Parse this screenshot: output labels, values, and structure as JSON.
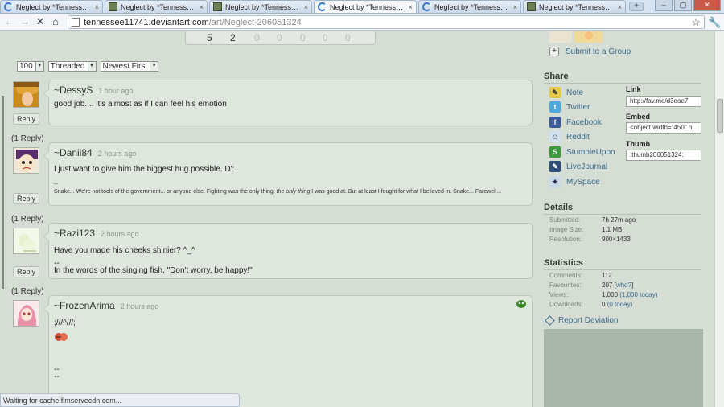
{
  "browser": {
    "tabs": [
      {
        "title": "Neglect by *Tennessee11...",
        "active": false
      },
      {
        "title": "Neglect by *Tennessee11...",
        "active": false
      },
      {
        "title": "Neglect by *Tennessee11...",
        "active": false
      },
      {
        "title": "Neglect by *Tennessee11...",
        "active": true
      },
      {
        "title": "Neglect by *Tennessee11...",
        "active": false
      },
      {
        "title": "Neglect by *Tennessee11...",
        "active": false
      }
    ],
    "new_tab_symbol": "+",
    "url_host": "tennessee11741.deviantart.com",
    "url_path": "/art/Neglect-206051324",
    "status_text": "Waiting for cache.fimservecdn.com...",
    "icons": {
      "back": "back-arrow-icon",
      "forward": "forward-arrow-icon",
      "stop": "stop-icon",
      "home": "home-icon",
      "star": "star-icon",
      "wrench": "wrench-icon"
    }
  },
  "pager": {
    "numbers": [
      "5",
      "2",
      "0",
      "0",
      "0",
      "0",
      "0"
    ]
  },
  "comment_controls": {
    "per_page": "100",
    "view": "Threaded",
    "order": "Newest First"
  },
  "comments": [
    {
      "user": "~DessyS",
      "time": "1 hour ago",
      "body": "good job.... it's almost as if I can feel his emotion",
      "reply_label": "Reply",
      "reply_count": "(1 Reply)"
    },
    {
      "user": "~Danii84",
      "time": "2 hours ago",
      "body": "I just want to give him the biggest hug possible. D':",
      "sig_dash": "--",
      "sig_pre": "Snake... We're not tools of the government... or anyone else. Fighting was the only thing, ",
      "sig_italic": "the only thing",
      "sig_post": " I was good at. But at least I fought for what I believed in. Snake... Farewell...",
      "reply_label": "Reply",
      "reply_count": "(1 Reply)"
    },
    {
      "user": "~Razi123",
      "time": "2 hours ago",
      "body": "Have you made his cheeks shinier? ^_^",
      "sig_dash": "--",
      "sig": "In the words of the singing fish, \"Don't worry, be happy!\"",
      "reply_label": "Reply",
      "reply_count": "(1 Reply)"
    },
    {
      "user": "~FrozenArima",
      "time": "2 hours ago",
      "body": ";///^///;",
      "dash1": "--",
      "dash2": "--",
      "dash3": "--"
    }
  ],
  "sidebar": {
    "submit_group": "Submit to a Group",
    "share_heading": "Share",
    "share_items": [
      "Note",
      "Twitter",
      "Facebook",
      "Reddit",
      "StumbleUpon",
      "LiveJournal",
      "MySpace"
    ],
    "link_label": "Link",
    "link_value": "http://fav.me/d3eoe7",
    "embed_label": "Embed",
    "embed_value": "<object width=\"450\" h",
    "thumb_label": "Thumb",
    "thumb_value": ":thumb206051324:",
    "details_heading": "Details",
    "details": [
      {
        "k": "Submitted:",
        "v": "7h 27m ago"
      },
      {
        "k": "Image Size:",
        "v": "1.1 MB"
      },
      {
        "k": "Resolution:",
        "v": "900×1433"
      }
    ],
    "statistics_heading": "Statistics",
    "stats": {
      "comments_k": "Comments:",
      "comments_v": "112",
      "favourites_k": "Favourites:",
      "favourites_v": "207",
      "favourites_link": "who?",
      "views_k": "Views:",
      "views_v": "1,000",
      "views_today": "(1,000 today)",
      "downloads_k": "Downloads:",
      "downloads_v": "0",
      "downloads_today": "(0 today)"
    },
    "report": "Report Deviation"
  },
  "colors": {
    "page_bg": "#d5ddd4",
    "link": "#3d6a8a",
    "comment_bg": "#dfe6de"
  }
}
